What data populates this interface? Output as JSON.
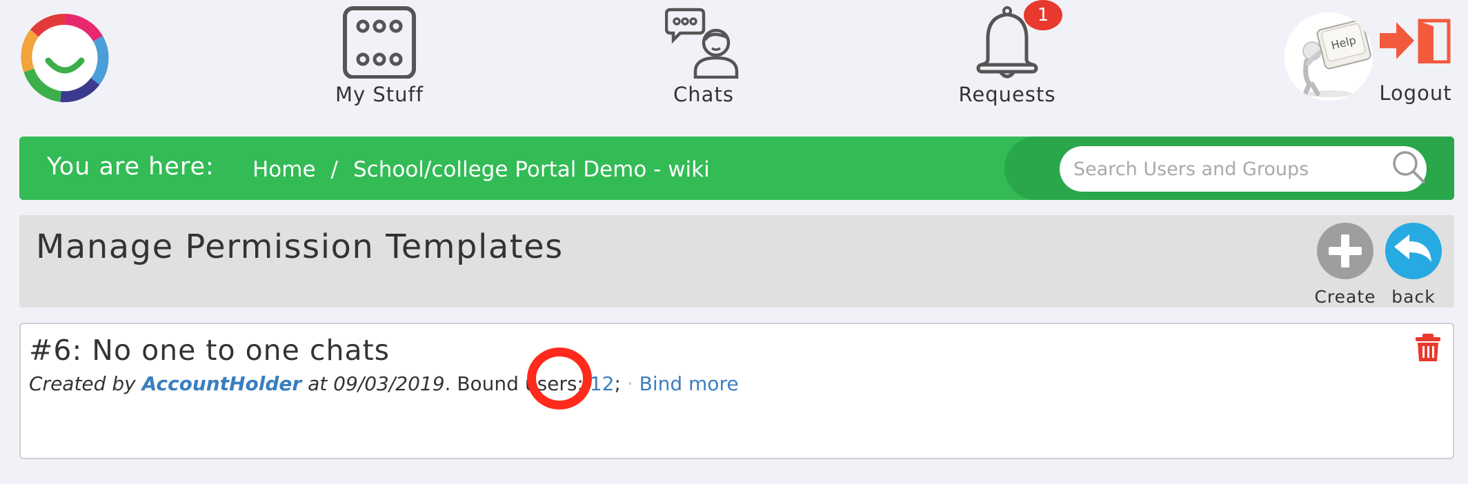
{
  "nav": {
    "my_stuff": "My Stuff",
    "chats": "Chats",
    "requests": "Requests",
    "requests_badge": "1",
    "help_key_text": "Help",
    "logout": "Logout"
  },
  "breadcrumb": {
    "title": "You are here:",
    "home": "Home",
    "separator": "/",
    "current": "School/college Portal Demo - wiki"
  },
  "search": {
    "placeholder": "Search Users and Groups"
  },
  "page": {
    "title": "Manage Permission Templates",
    "create_label": "Create",
    "back_label": "back"
  },
  "template": {
    "title": "#6: No one to one chats",
    "created_by_prefix": "Created by",
    "author": "AccountHolder",
    "at_date": "at 09/03/2019",
    "bound_users_label": ". Bound users:",
    "bound_users_count": "12",
    "separator": ";",
    "bind_more": "Bind more"
  },
  "colors": {
    "green": "#33bb56",
    "link": "#3a7fbf",
    "badge_red": "#e8392e",
    "back_blue": "#27aae1",
    "highlight_red": "#ff2a1c"
  }
}
